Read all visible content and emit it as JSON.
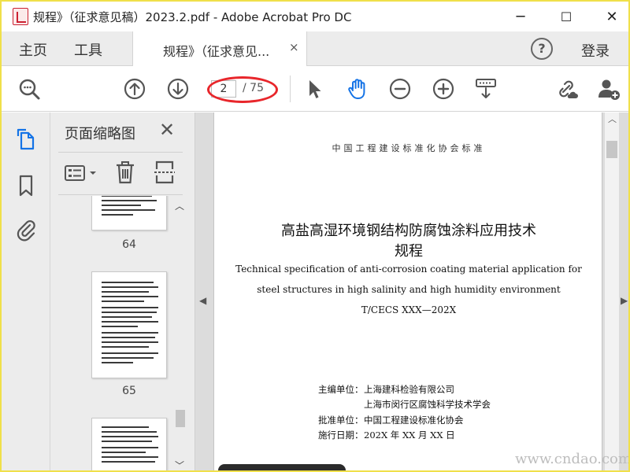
{
  "window": {
    "title": "规程》（征求意见稿）2023.2.pdf - Adobe Acrobat Pro DC",
    "minimize": "─",
    "maximize": "☐",
    "close": "✕"
  },
  "tabbar": {
    "home": "主页",
    "tools": "工具",
    "doc_tab_label": "规程》（征求意见...",
    "doc_tab_close": "×",
    "help": "?",
    "login": "登录"
  },
  "toolbar": {
    "current_page": "2",
    "total_pages": "/ 75"
  },
  "thumb_panel": {
    "title": "页面缩略图",
    "close": "✕",
    "pages": [
      "64",
      "65"
    ]
  },
  "document": {
    "association": "中国工程建设标准化协会标准",
    "title_line1": "高盐高湿环境钢结构防腐蚀涂料应用技术",
    "title_line2": "规程",
    "english_line1": "Technical specification of anti-corrosion coating material application for",
    "english_line2": "steel structures in high salinity and high humidity environment",
    "code": "T/CECS XXX—202X",
    "editor_label": "主编单位：",
    "editor_1": "上海建科检验有限公司",
    "editor_2": "上海市闵行区腐蚀科学技术学会",
    "approver_label": "批准单位：",
    "approver": "中国工程建设标准化协会",
    "date_label": "施行日期：",
    "date": "202X 年 XX 月 XX 日"
  },
  "watermark": "www.cndao.com",
  "colors": {
    "accent": "#1473e6",
    "highlight_oval": "#e8262b",
    "window_border": "#f0e04a",
    "chrome": "#ececec"
  },
  "icons": {
    "zoom": "magnifier-icon",
    "prev_page": "arrow-up-circle-icon",
    "next_page": "arrow-down-circle-icon",
    "select": "cursor-arrow-icon",
    "hand": "hand-icon",
    "zoom_out": "minus-circle-icon",
    "zoom_in": "plus-circle-icon",
    "scroll_mode": "keyboard-scroll-icon",
    "link_cloud": "link-cloud-icon",
    "add_user": "add-user-icon",
    "thumbnails": "pages-icon",
    "bookmarks": "bookmark-icon",
    "attachments": "paperclip-icon",
    "options": "list-options-icon",
    "delete": "trash-icon",
    "extract": "extract-page-icon"
  }
}
